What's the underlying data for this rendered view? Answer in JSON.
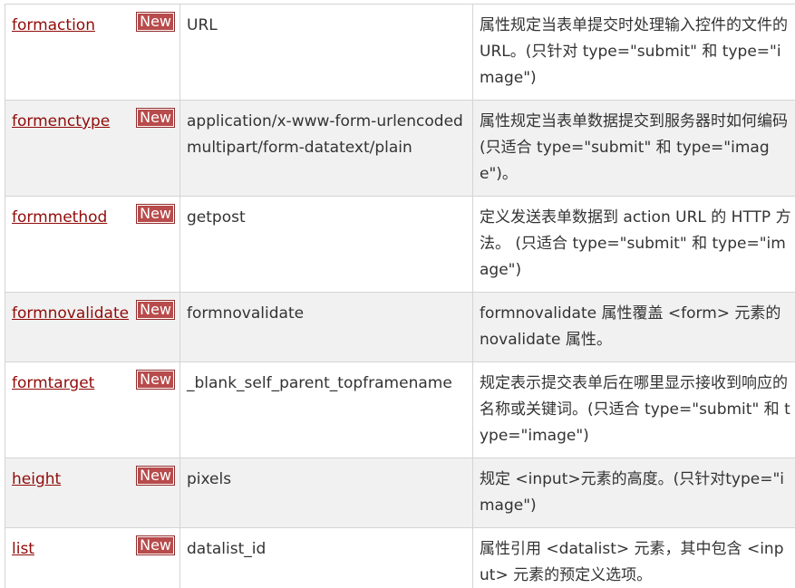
{
  "table": {
    "rows": [
      {
        "name": "formaction",
        "badge": "New",
        "value": "URL",
        "description": "属性规定当表单提交时处理输入控件的文件的 URL。(只针对 type=\"submit\" 和 type=\"image\")"
      },
      {
        "name": "formenctype",
        "badge": "New",
        "value": "application/x-www-form-urlencodedmultipart/form-datatext/plain",
        "description": "属性规定当表单数据提交到服务器时如何编码(只适合 type=\"submit\" 和 type=\"image\")。"
      },
      {
        "name": "formmethod",
        "badge": "New",
        "value": "getpost",
        "description": "定义发送表单数据到 action URL 的 HTTP 方法。 (只适合 type=\"submit\" 和 type=\"image\")"
      },
      {
        "name": "formnovalidate",
        "badge": "New",
        "value": "formnovalidate",
        "description": "formnovalidate 属性覆盖 <form> 元素的 novalidate 属性。"
      },
      {
        "name": "formtarget",
        "badge": "New",
        "value": "_blank_self_parent_topframename",
        "description": "规定表示提交表单后在哪里显示接收到响应的名称或关键词。(只适合 type=\"submit\" 和 type=\"image\")"
      },
      {
        "name": "height",
        "badge": "New",
        "value": "pixels",
        "description": "规定 <input>元素的高度。(只针对type=\"image\")"
      },
      {
        "name": "list",
        "badge": "New",
        "value": "datalist_id",
        "description": "属性引用 <datalist> 元素，其中包含 <input> 元素的预定义选项。"
      }
    ]
  }
}
